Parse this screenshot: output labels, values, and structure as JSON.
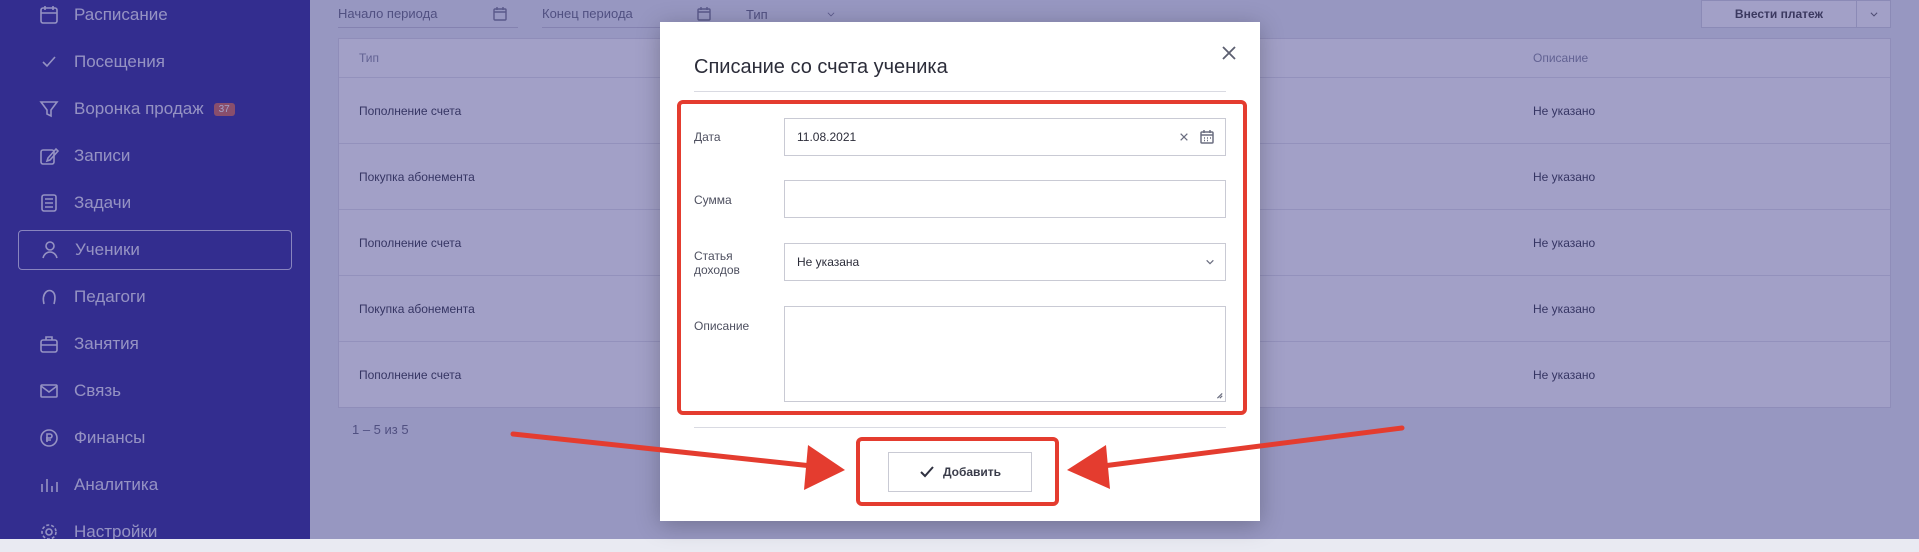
{
  "sidebar": {
    "items": [
      {
        "label": "Расписание",
        "icon": "calendar-icon"
      },
      {
        "label": "Посещения",
        "icon": "checkmark-icon"
      },
      {
        "label": "Воронка продаж",
        "icon": "funnel-icon",
        "badge": "37"
      },
      {
        "label": "Записи",
        "icon": "edit-icon"
      },
      {
        "label": "Задачи",
        "icon": "tasks-icon"
      },
      {
        "label": "Ученики",
        "icon": "user-icon",
        "active": true
      },
      {
        "label": "Педагоги",
        "icon": "teacher-icon"
      },
      {
        "label": "Занятия",
        "icon": "briefcase-icon"
      },
      {
        "label": "Связь",
        "icon": "mail-icon"
      },
      {
        "label": "Финансы",
        "icon": "money-icon"
      },
      {
        "label": "Аналитика",
        "icon": "analytics-icon"
      },
      {
        "label": "Настройки",
        "icon": "settings-icon"
      }
    ]
  },
  "filters": {
    "period_start": "Начало периода",
    "period_end": "Конец периода",
    "type": "Тип",
    "pay_button": "Внести платеж"
  },
  "table": {
    "headers": {
      "type": "Тип",
      "description": "Описание"
    },
    "rows": [
      {
        "type": "Пополнение счета",
        "description": "Не указано"
      },
      {
        "type": "Покупка абонемента",
        "description": "Не указано"
      },
      {
        "type": "Пополнение счета",
        "description": "Не указано"
      },
      {
        "type": "Покупка абонемента",
        "description": "Не указано"
      },
      {
        "type": "Пополнение счета",
        "description": "Не указано"
      }
    ],
    "pagination": "1 – 5 из 5"
  },
  "modal": {
    "title": "Списание со счета ученика",
    "fields": {
      "date_label": "Дата",
      "date_value": "11.08.2021",
      "amount_label": "Сумма",
      "amount_value": "",
      "income_label_line1": "Статья",
      "income_label_line2": "доходов",
      "income_value": "Не указана",
      "description_label": "Описание",
      "description_value": ""
    },
    "add_button": "Добавить"
  },
  "colors": {
    "sidebar": "#362f9a",
    "highlight": "#e43c2f",
    "badge": "#d26a5a"
  }
}
